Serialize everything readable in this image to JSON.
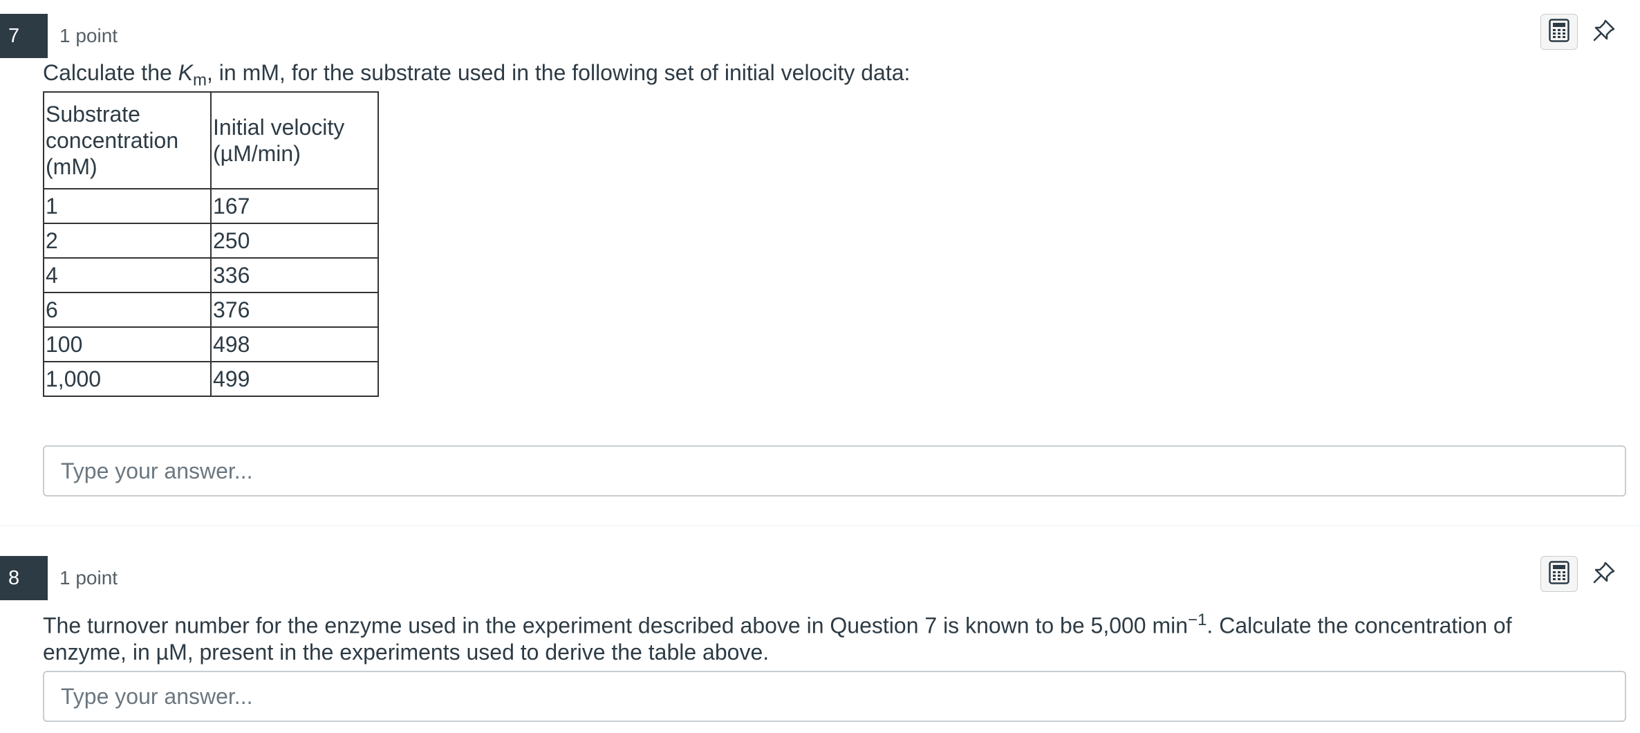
{
  "questions": [
    {
      "number": "7",
      "points": "1 point",
      "text_before": "Calculate the ",
      "km_K": "K",
      "km_sub": "m",
      "text_after": ", in mM, for the substrate used in the following set of initial velocity data:",
      "table": {
        "headers": [
          "Substrate concentration (mM)",
          "Initial velocity (µM/min)"
        ],
        "rows": [
          [
            "1",
            "167"
          ],
          [
            "2",
            "250"
          ],
          [
            "4",
            "336"
          ],
          [
            "6",
            "376"
          ],
          [
            "100",
            "498"
          ],
          [
            "1,000",
            "499"
          ]
        ]
      },
      "answer_placeholder": "Type your answer..."
    },
    {
      "number": "8",
      "points": "1 point",
      "text_part1": "The turnover number for the enzyme used in the experiment described above in Question 7 is known to be 5,000 min",
      "text_sup": "−1",
      "text_part2": ". Calculate the concentration of enzyme, in µM, present in the experiments used to derive the table above.",
      "answer_placeholder": "Type your answer..."
    }
  ],
  "icons": {
    "calculator": "calculator-icon",
    "pin": "pin-icon"
  }
}
